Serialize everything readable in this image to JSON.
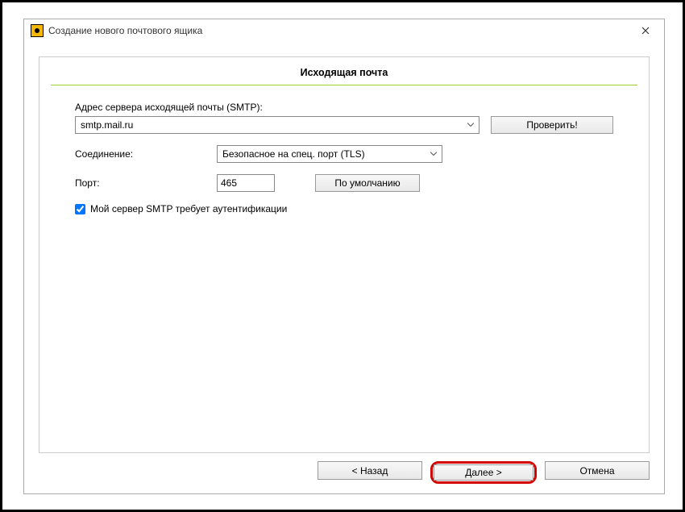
{
  "window": {
    "title": "Создание нового почтового ящика"
  },
  "panel": {
    "heading": "Исходящая почта"
  },
  "form": {
    "server_label": "Адрес сервера исходящей почты (SMTP):",
    "server_value": "smtp.mail.ru",
    "check_button": "Проверить!",
    "connection_label": "Соединение:",
    "connection_value": "Безопасное на спец. порт (TLS)",
    "port_label": "Порт:",
    "port_value": "465",
    "default_button": "По умолчанию",
    "auth_checkbox_label": "Мой сервер SMTP требует аутентификации",
    "auth_checked": true
  },
  "footer": {
    "back": "<   Назад",
    "next": "Далее   >",
    "cancel": "Отмена"
  }
}
